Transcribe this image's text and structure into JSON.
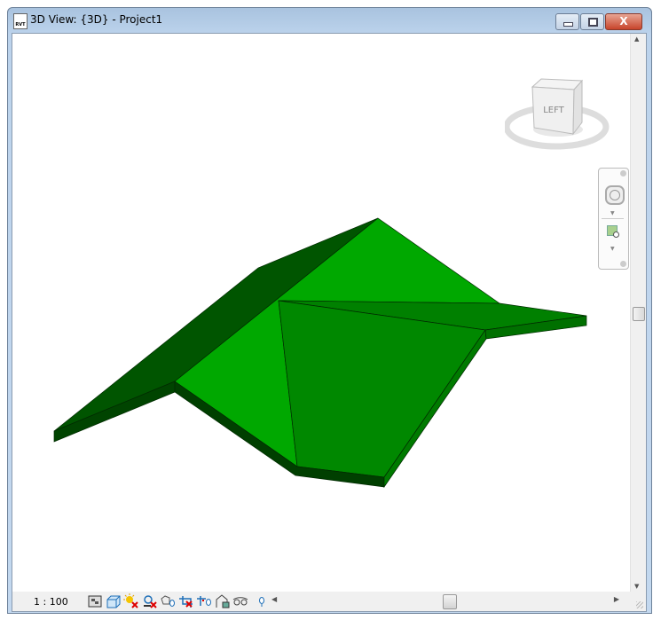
{
  "window": {
    "title": "3D View: {3D} - Project1",
    "app_icon_text": "RVT",
    "close_label": "X"
  },
  "viewcube": {
    "face_label": "LEFT"
  },
  "model": {
    "colors": {
      "light": "#00a800",
      "medium": "#008800",
      "dark": "#005500",
      "edge": "#003f00"
    }
  },
  "status_bar": {
    "scale": "1 : 100",
    "icons": [
      "detail-level-icon",
      "visual-style-icon",
      "sun-path-off-icon",
      "shadows-off-icon",
      "render-dialog-icon",
      "crop-view-off-icon",
      "show-crop-region-icon",
      "unlocked-3d-view-icon",
      "temporary-hide-isolate-icon",
      "reveal-hidden-elements-icon"
    ]
  }
}
